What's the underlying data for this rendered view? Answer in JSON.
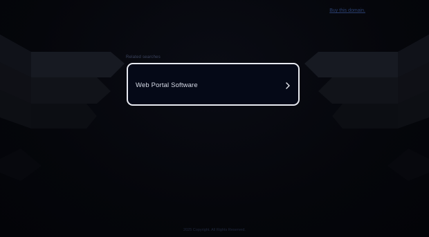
{
  "header": {
    "domain_link": "Buy this domain."
  },
  "related": {
    "label": "Related searches",
    "items": [
      {
        "label": "Web Portal Software",
        "icon": "chevron-right-icon"
      }
    ]
  },
  "footer": {
    "text": "2025 Copyright. All Rights Reserved."
  },
  "colors": {
    "background": "#05060b",
    "card_border": "#e9ebf2",
    "card_background": "#050917",
    "card_text": "#d8dce8",
    "link": "#2a3f70"
  }
}
